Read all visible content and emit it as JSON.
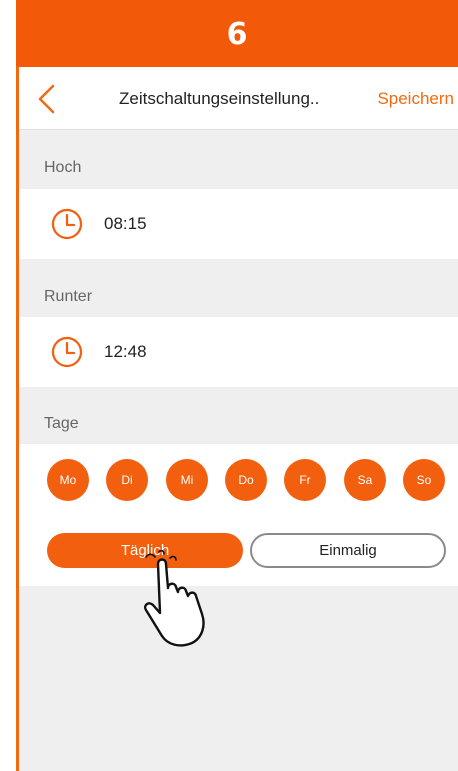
{
  "step": {
    "number": "6"
  },
  "header": {
    "title": "Zeitschaltungseinstellung..",
    "save_label": "Speichern"
  },
  "up": {
    "label": "Hoch",
    "time": "08:15"
  },
  "down": {
    "label": "Runter",
    "time": "12:48"
  },
  "days": {
    "label": "Tage",
    "items": [
      "Mo",
      "Di",
      "Mi",
      "Do",
      "Fr",
      "Sa",
      "So"
    ]
  },
  "repeat": {
    "daily_label": "Täglich",
    "once_label": "Einmalig",
    "selected": "daily"
  },
  "colors": {
    "accent": "#f25f0e",
    "banner": "#f25a0a",
    "background": "#efefef"
  },
  "icons": [
    "back-chevron-icon",
    "clock-icon",
    "pointing-hand-icon"
  ]
}
